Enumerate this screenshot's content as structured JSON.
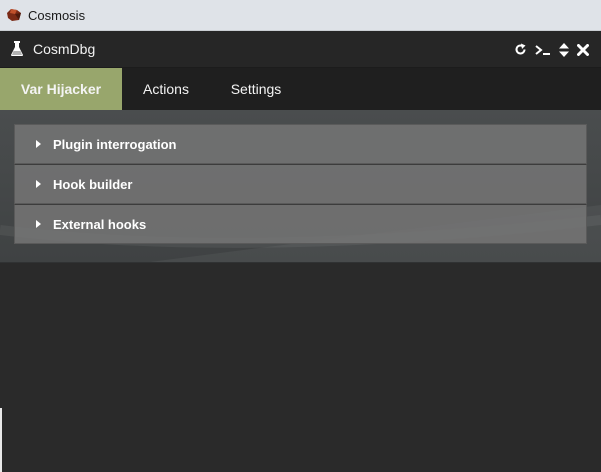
{
  "window": {
    "title": "Cosmosis"
  },
  "panel": {
    "title": "CosmDbg",
    "actions": [
      {
        "icon": "refresh-icon"
      },
      {
        "icon": "terminal-icon"
      },
      {
        "icon": "sort-icon"
      },
      {
        "icon": "close-icon"
      }
    ]
  },
  "tabs": [
    {
      "label": "Var Hijacker",
      "active": true
    },
    {
      "label": "Actions",
      "active": false
    },
    {
      "label": "Settings",
      "active": false
    }
  ],
  "sections": [
    {
      "label": "Plugin interrogation",
      "expanded": false
    },
    {
      "label": "Hook builder",
      "expanded": false
    },
    {
      "label": "External hooks",
      "expanded": false
    }
  ],
  "colors": {
    "active_tab": "#98a66c",
    "header_bg": "#262626",
    "content_bg": "#4a4d4e"
  }
}
